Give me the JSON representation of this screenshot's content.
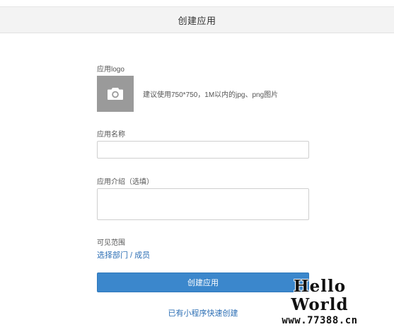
{
  "header": {
    "title": "创建应用"
  },
  "form": {
    "logo": {
      "label": "应用logo",
      "icon": "camera-icon",
      "hint": "建议使用750*750，1M以内的jpg、png图片"
    },
    "name": {
      "label": "应用名称",
      "value": "",
      "placeholder": ""
    },
    "intro": {
      "label": "应用介绍（选填）",
      "value": "",
      "placeholder": ""
    },
    "visibility": {
      "label": "可见范围",
      "link": "选择部门 / 成员"
    },
    "submit_label": "创建应用",
    "quick_create_link": "已有小程序快速创建"
  },
  "watermark": {
    "title": "Hello World",
    "url": "www.77388.cn"
  },
  "colors": {
    "header_bg": "#f3f3f3",
    "primary_button": "#3b87cc",
    "link": "#2d6fb5",
    "logo_placeholder": "#9a9a9a"
  }
}
